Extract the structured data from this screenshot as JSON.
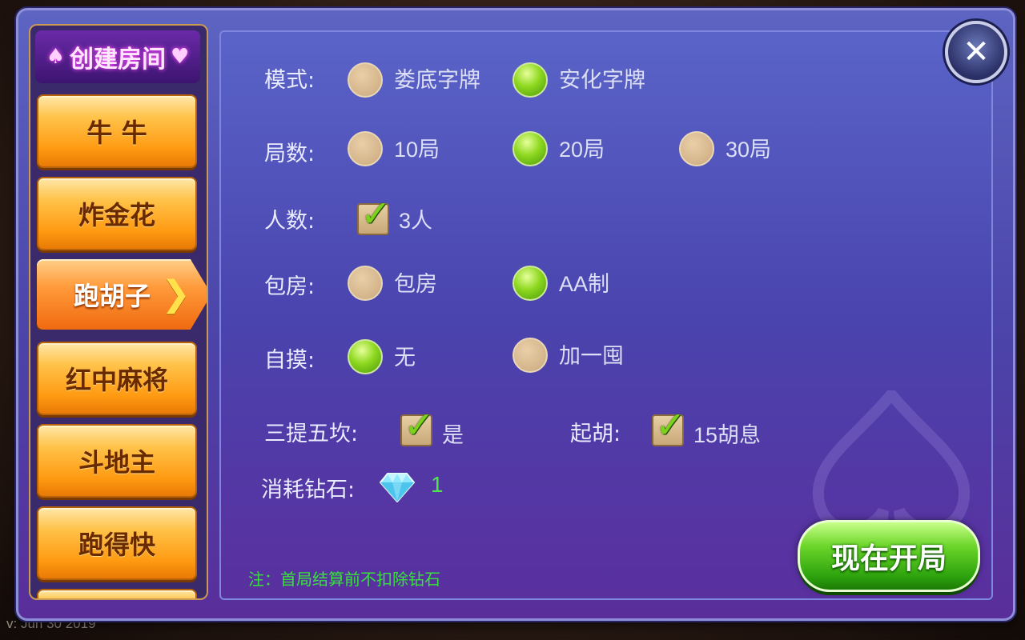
{
  "version": "v: Jun 30 2019",
  "sidebar": {
    "title": "创建房间",
    "title_left_suit": "♠",
    "title_right_suit": "♥",
    "items": [
      {
        "label": "牛 牛"
      },
      {
        "label": "炸金花"
      },
      {
        "label": "跑胡子",
        "active": true
      },
      {
        "label": "红中麻将"
      },
      {
        "label": "斗地主"
      },
      {
        "label": "跑得快"
      }
    ]
  },
  "close": {
    "icon": "close-icon",
    "glyph": "✕"
  },
  "form": {
    "mode": {
      "label": "模式:",
      "options": [
        "娄底字牌",
        "安化字牌"
      ],
      "selected": "安化字牌"
    },
    "rounds": {
      "label": "局数:",
      "options": [
        "10局",
        "20局",
        "30局"
      ],
      "selected": "20局"
    },
    "players": {
      "label": "人数:",
      "option": "3人",
      "checked": true
    },
    "room": {
      "label": "包房:",
      "options": [
        "包房",
        "AA制"
      ],
      "selected": "AA制"
    },
    "selfdraw": {
      "label": "自摸:",
      "options": [
        "无",
        "加一囤"
      ],
      "selected": "无"
    },
    "santi": {
      "label": "三提五坎:",
      "option": "是",
      "checked": true
    },
    "qihu": {
      "label": "起胡:",
      "option": "15胡息",
      "checked": true
    },
    "cost": {
      "label": "消耗钻石:",
      "value": "1",
      "icon": "diamond-icon"
    }
  },
  "note": "注：首局结算前不扣除钻石",
  "start_button": "现在开局",
  "colors": {
    "accent_green": "#36e23a",
    "panel_purple": "#4a44ae",
    "tab_orange": "#ff9a12"
  }
}
